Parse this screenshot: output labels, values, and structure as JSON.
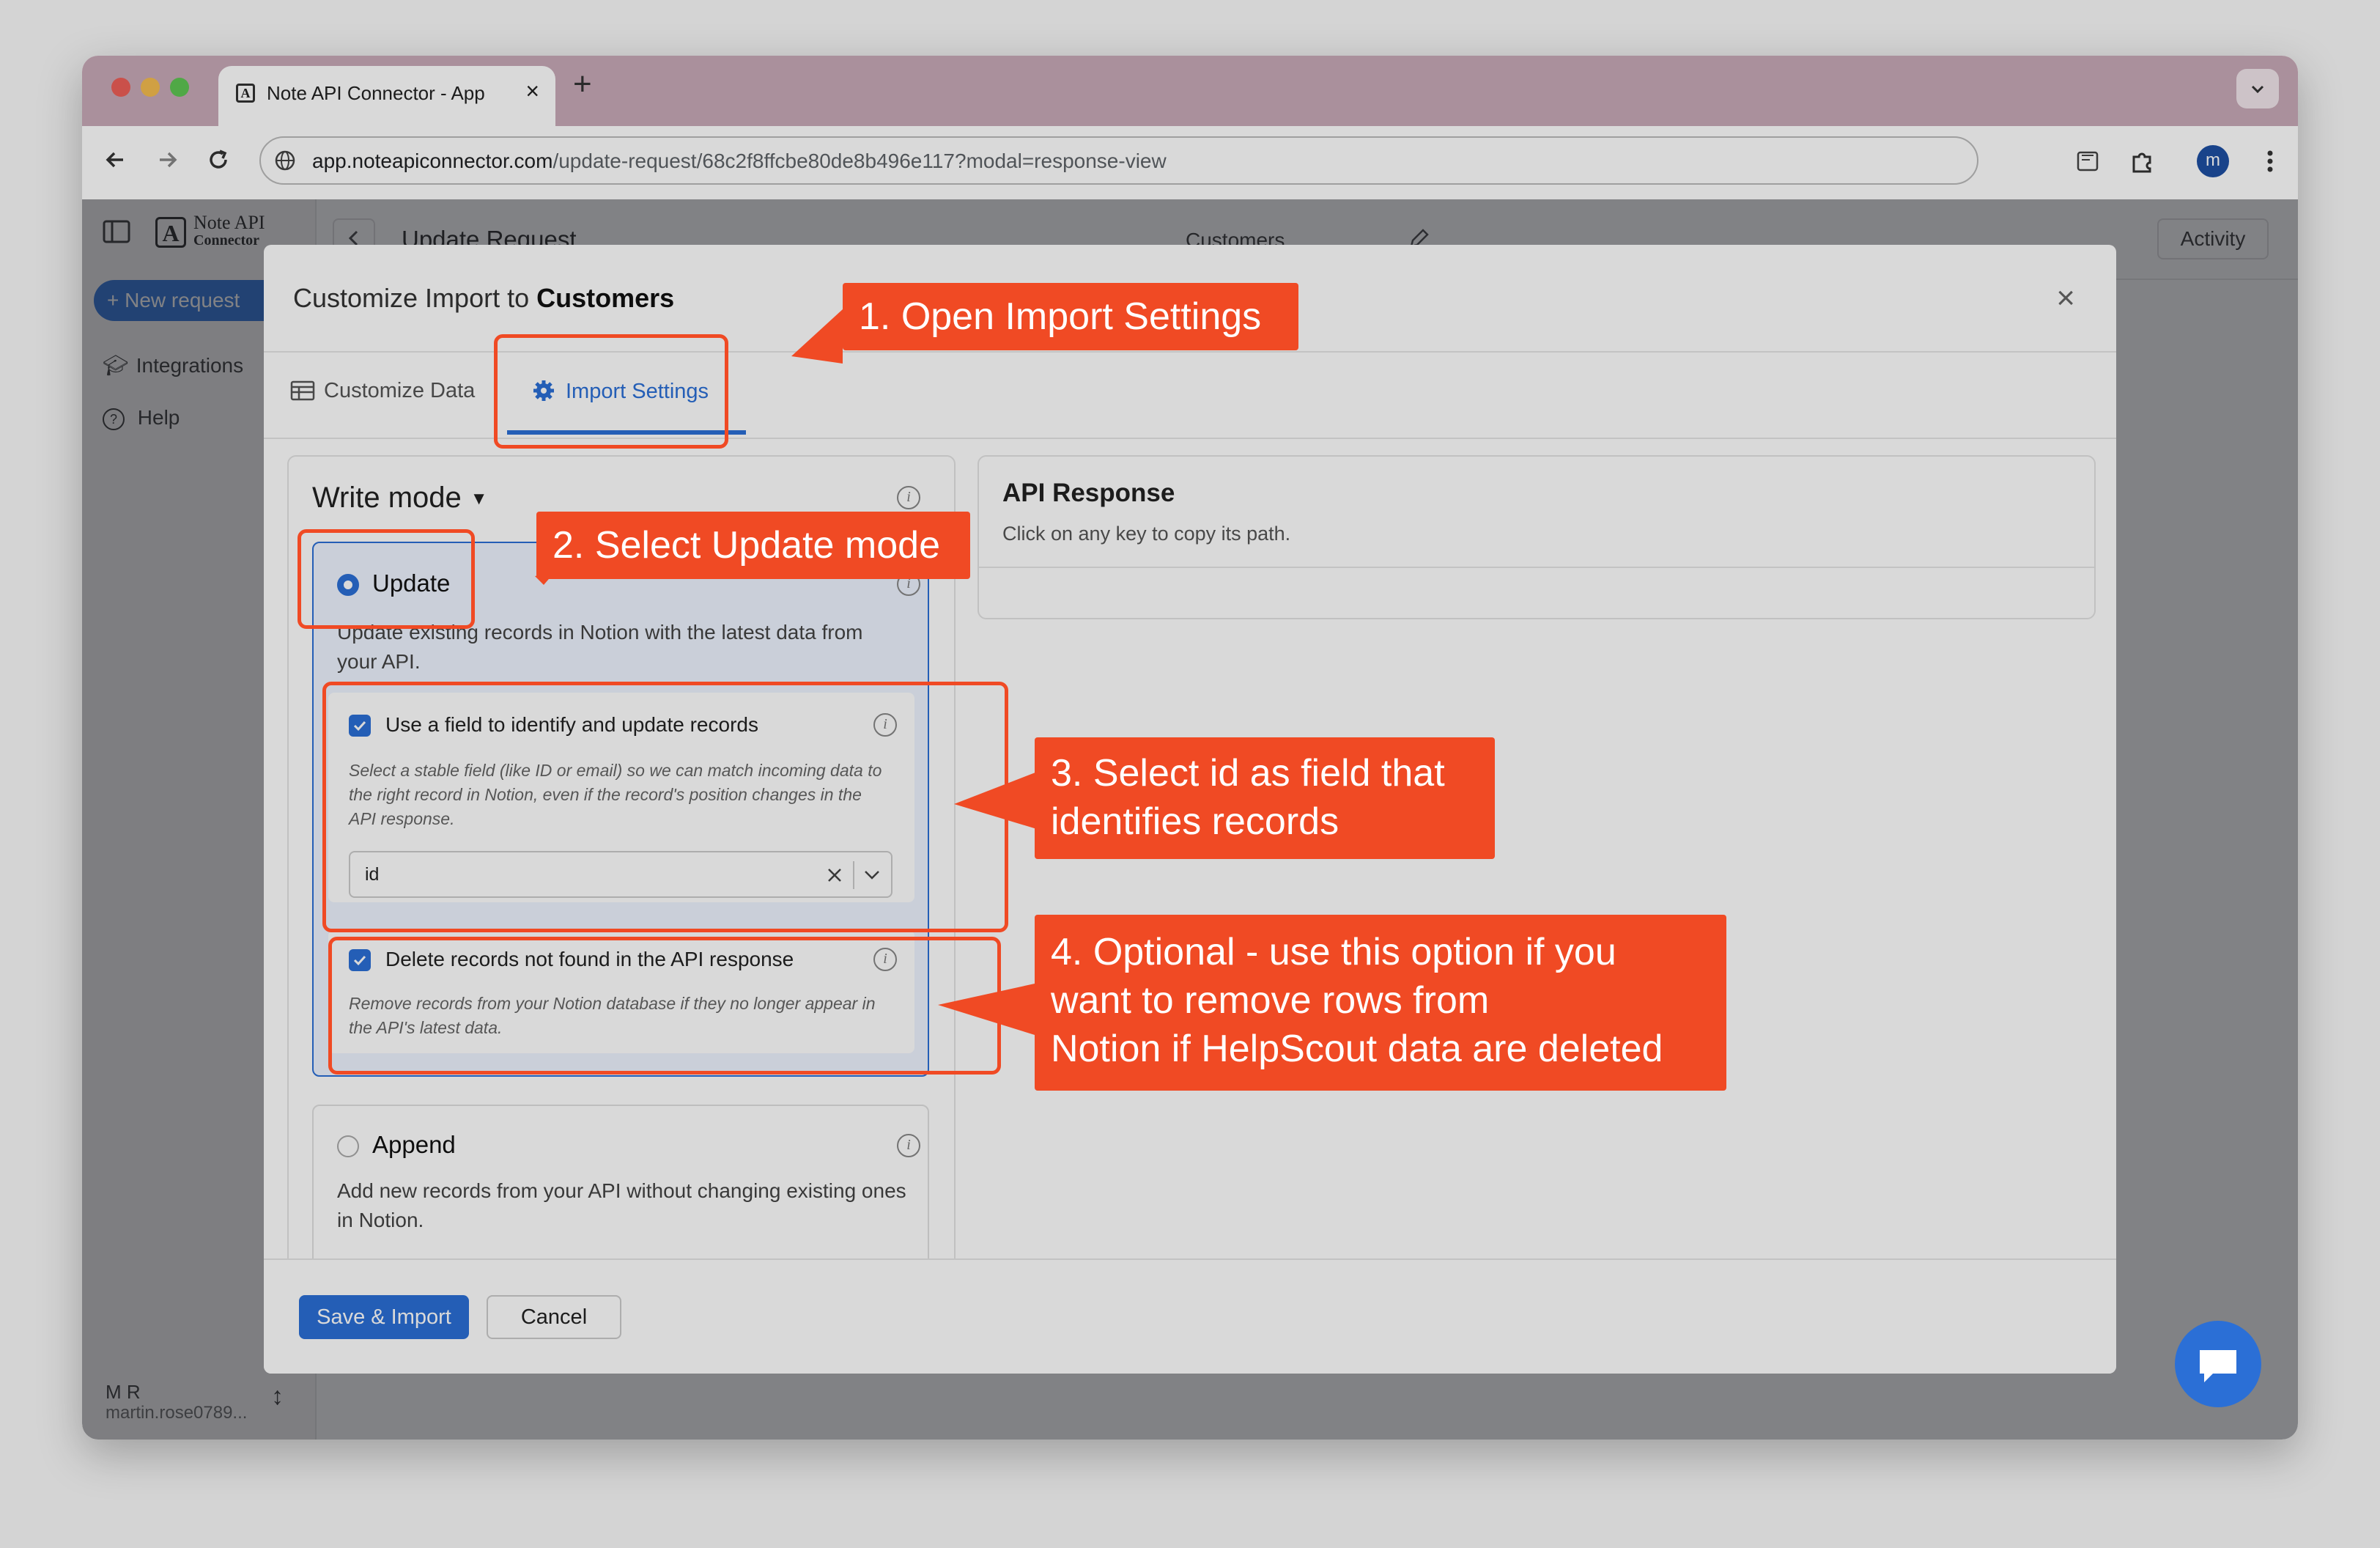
{
  "browser": {
    "tab_title": "Note API Connector - App",
    "tab_close": "×",
    "new_tab": "+",
    "url_host": "app.noteapiconnector.com",
    "url_path": "/update-request/68c2f8ffcbe80de8b496e117?modal=response-view",
    "profile_initial": "m"
  },
  "app": {
    "logo_line1": "Note API",
    "logo_line2": "Connector",
    "logo_glyph": "A",
    "new_request_label": "+ New request",
    "sidebar_items": [
      {
        "label": "Integrations",
        "icon": "graduation-cap-icon"
      },
      {
        "label": "Help",
        "icon": "question-circle-icon"
      }
    ],
    "header_title": "Update Request",
    "header_center": "Customers",
    "activity_label": "Activity",
    "user_name": "M R",
    "user_email": "martin.rose0789...",
    "user_switch": "↕"
  },
  "modal": {
    "title_prefix": "Customize Import to ",
    "title_bold": "Customers",
    "close": "×",
    "tabs": [
      {
        "label": "Customize Data",
        "icon": "table-icon"
      },
      {
        "label": "Import Settings",
        "icon": "gear-icon"
      }
    ],
    "write_mode_label": "Write mode",
    "update_option": {
      "label": "Update",
      "description": "Update existing records in Notion with the latest data from your API.",
      "identify": {
        "label": "Use a field to identify and update records",
        "help": "Select a stable field (like ID or email) so we can match incoming data to the right record in Notion, even if the record's position changes in the API response.",
        "value": "id"
      },
      "delete": {
        "label": "Delete records not found in the API response",
        "help": "Remove records from your Notion database if they no longer appear in the API's latest data."
      }
    },
    "append_option": {
      "label": "Append",
      "description": "Add new records from your API without changing existing ones in Notion."
    },
    "api_response": {
      "title": "API Response",
      "subtitle": "Click on any key to copy its path."
    },
    "save_label": "Save & Import",
    "cancel_label": "Cancel"
  },
  "callouts": [
    {
      "text": "1. Open Import Settings"
    },
    {
      "text": "2. Select Update mode"
    },
    {
      "lines": [
        "3. Select id as field that",
        "identifies records"
      ]
    },
    {
      "lines": [
        "4. Optional - use this option if you",
        "want to remove rows from",
        "Notion if HelpScout data are deleted"
      ]
    }
  ],
  "colors": {
    "accent": "#2b6fd6",
    "callout": "#f04a24",
    "tabbar": "#c8aab8"
  }
}
